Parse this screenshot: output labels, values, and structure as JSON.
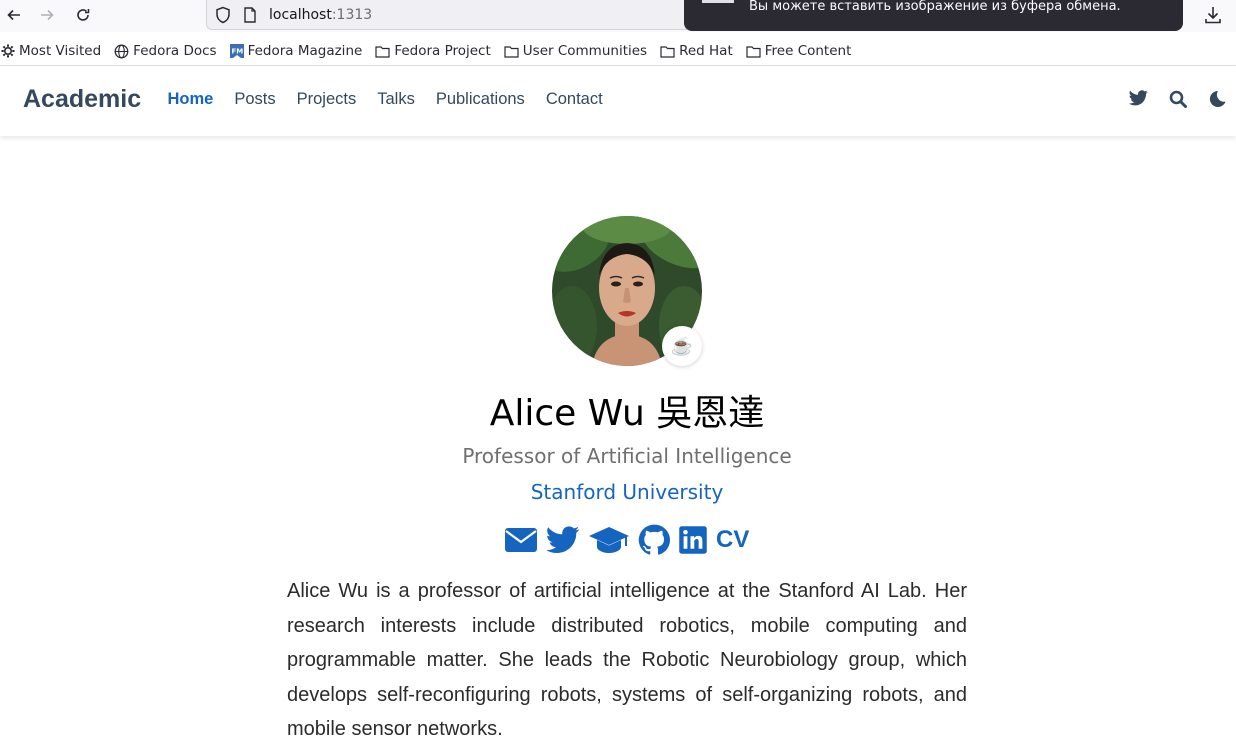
{
  "browser": {
    "url_host": "localhost",
    "url_port": ":1313",
    "toast_text": "Вы можете вставить изображение из буфера обмена.",
    "bookmarks": [
      {
        "label": "Most Visited",
        "icon": "gear-icon"
      },
      {
        "label": "Fedora Docs",
        "icon": "globe-icon"
      },
      {
        "label": "Fedora Magazine",
        "icon": "fedora-magazine-icon"
      },
      {
        "label": "Fedora Project",
        "icon": "folder-icon"
      },
      {
        "label": "User Communities",
        "icon": "folder-icon"
      },
      {
        "label": "Red Hat",
        "icon": "folder-icon"
      },
      {
        "label": "Free Content",
        "icon": "folder-icon"
      }
    ]
  },
  "navbar": {
    "brand": "Academic",
    "menu": [
      {
        "label": "Home",
        "active": true
      },
      {
        "label": "Posts",
        "active": false
      },
      {
        "label": "Projects",
        "active": false
      },
      {
        "label": "Talks",
        "active": false
      },
      {
        "label": "Publications",
        "active": false
      },
      {
        "label": "Contact",
        "active": false
      }
    ],
    "icons": [
      "twitter-icon",
      "search-icon",
      "moon-icon"
    ]
  },
  "profile": {
    "status_emoji": "☕️",
    "name": "Alice Wu 吳恩達",
    "role": "Professor of Artificial Intelligence",
    "organization": "Stanford University",
    "social": [
      "envelope-icon",
      "twitter-icon",
      "graduation-cap-icon",
      "github-icon",
      "linkedin-icon",
      "cv-icon"
    ],
    "cv_label": "CV",
    "bio": "Alice Wu is a professor of artificial intelligence at the Stanford AI Lab. Her research interests include distributed robotics, mobile computing and programmable matter. She leads the Robotic Neurobiology group, which develops self-reconfiguring robots, systems of self-organizing robots, and mobile sensor networks."
  },
  "colors": {
    "accent": "#1565c0",
    "text": "#34495e"
  }
}
